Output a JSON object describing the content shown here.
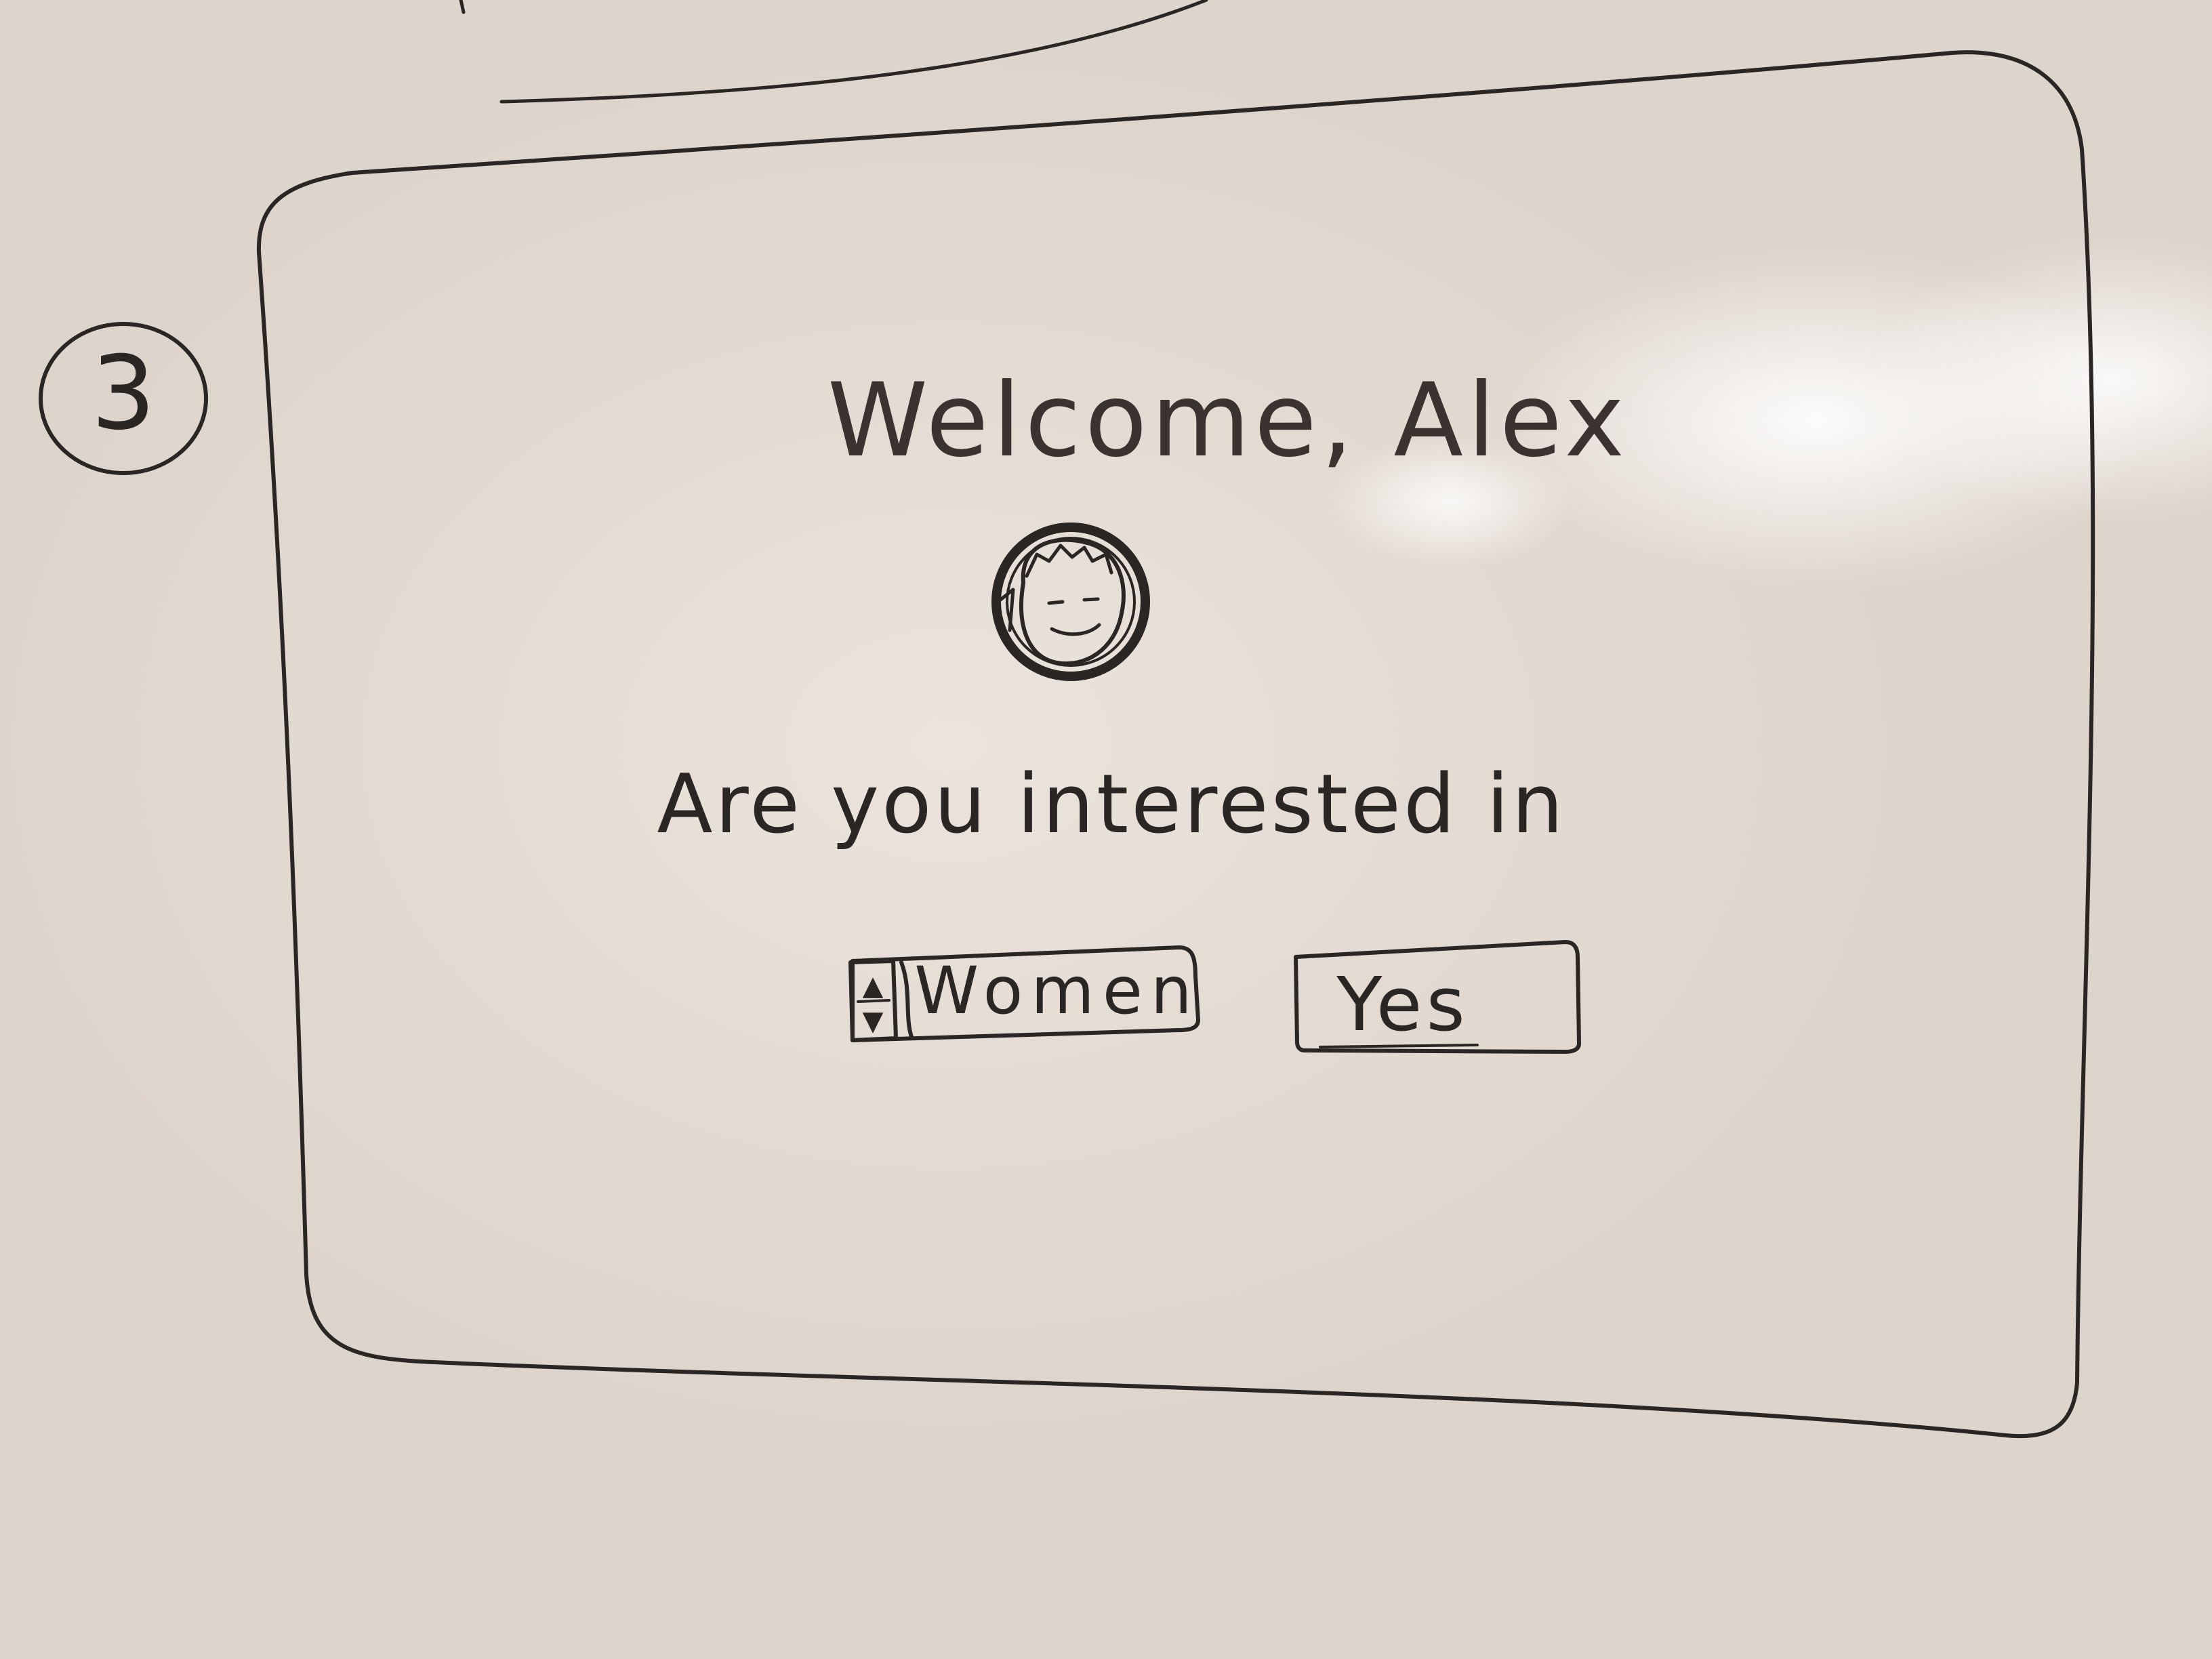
{
  "step_marker": "3",
  "screen": {
    "welcome_heading": "Welcome, Alex",
    "question": "Are you interested in",
    "interest_select": {
      "selected_value": "Women",
      "stepper_up": "▲",
      "stepper_down": "▼"
    },
    "confirm_button": {
      "label": "Yes"
    }
  }
}
